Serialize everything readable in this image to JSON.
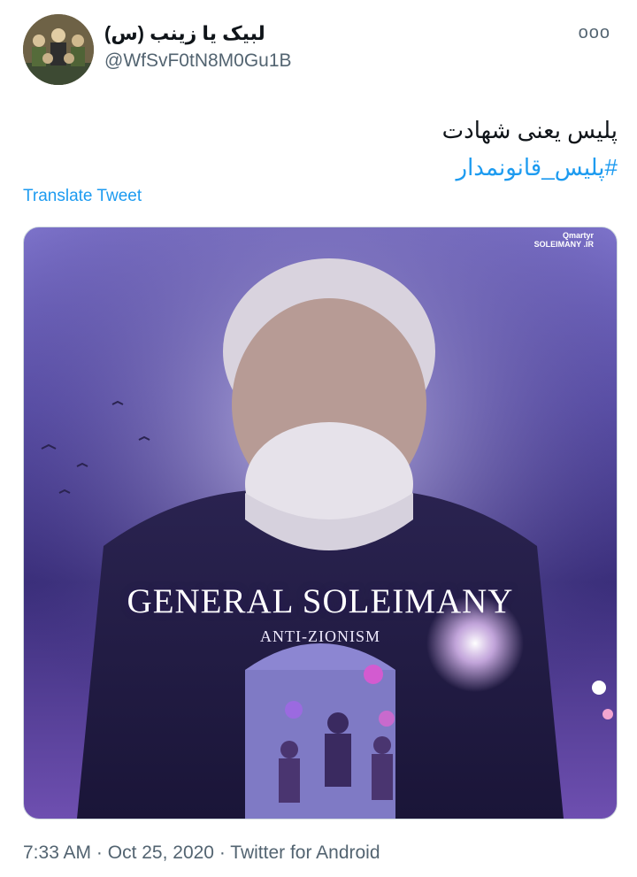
{
  "user": {
    "display_name": "لبیک یا زینب (س)",
    "handle": "@WfSvF0tN8M0Gu1B",
    "avatar_icon": "group-photo-avatar"
  },
  "more_icon": "ooo",
  "tweet": {
    "line1": "پلیس یعنی شهادت",
    "hashtag": "#پلیس_قانونمدار"
  },
  "translate_label": "Translate Tweet",
  "media": {
    "title": "GENERAL SOLEIMANY",
    "subtitle": "ANTI-ZIONISM",
    "watermark_top": "Qmartyr",
    "watermark_bottom": "SOLEIMANY .IR",
    "alt": "poster"
  },
  "meta": {
    "time": "7:33 AM",
    "separator": " · ",
    "date": "Oct 25, 2020",
    "source": "Twitter for Android"
  },
  "colors": {
    "link": "#1d9bf0",
    "secondary_text": "#536471",
    "poster_purple": "#5a4fa8"
  }
}
